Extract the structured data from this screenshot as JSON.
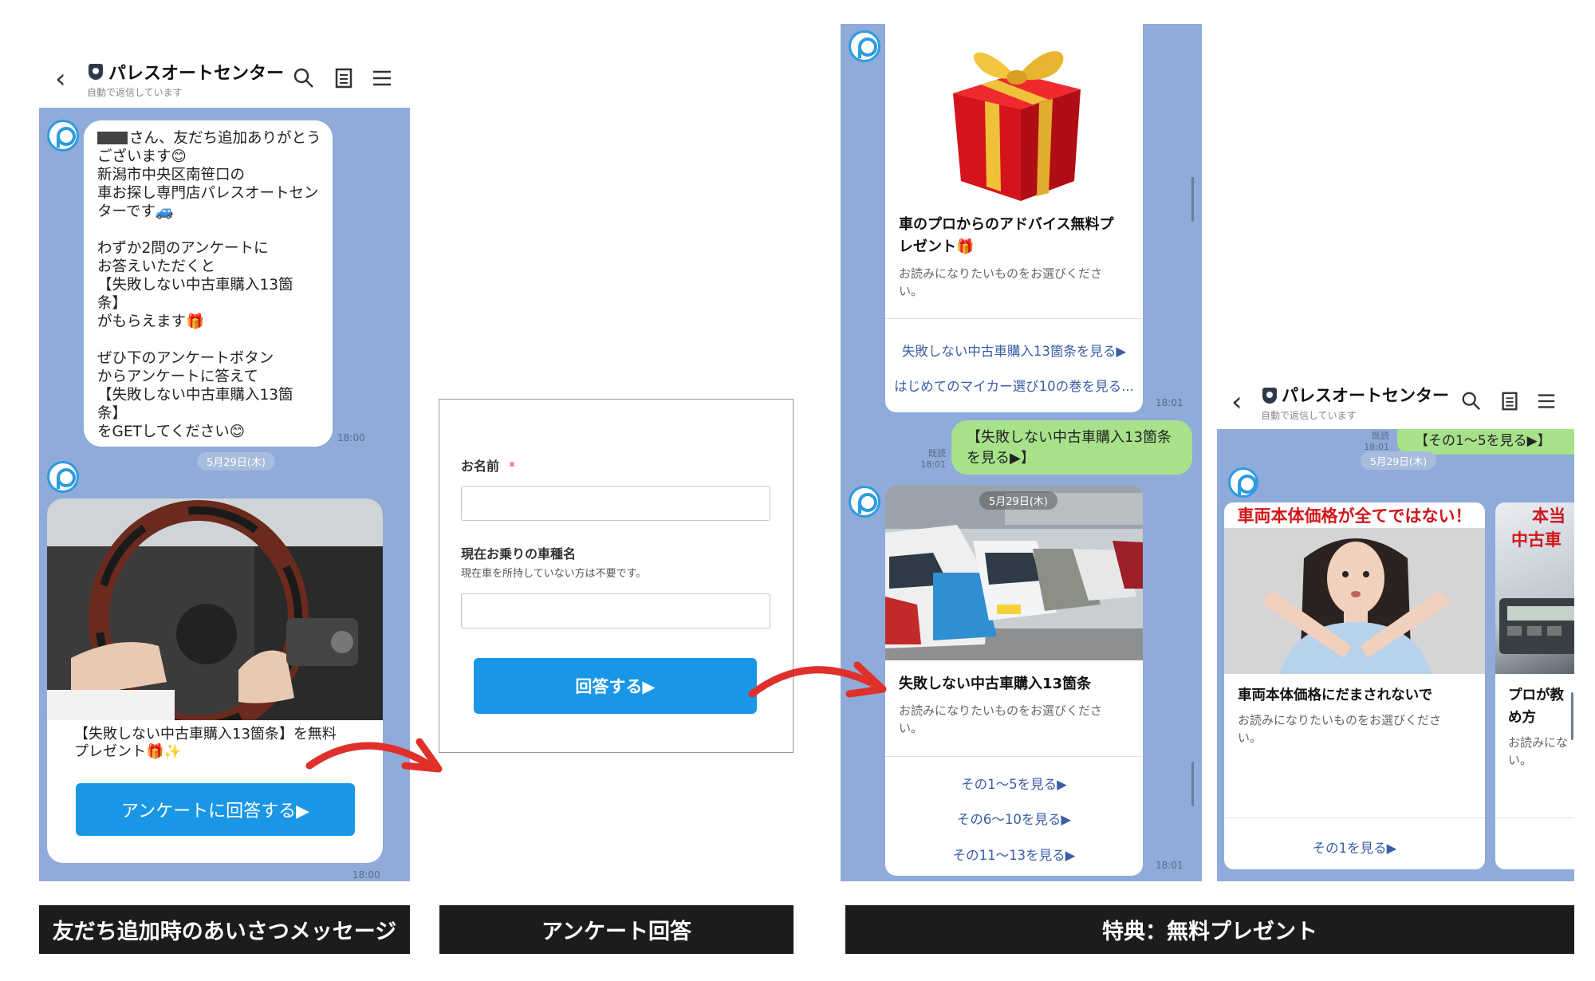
{
  "header": {
    "title": "パレスオートセンター",
    "subtitle": "自動で返信しています"
  },
  "panel1": {
    "greeting_parts": {
      "line1": "さん、友だち追加ありがとう",
      "rest": "ございます😊\n新潟市中央区南笹口の\n車お探し専門店パレスオートセン\nターです🚙\n\nわずか2問のアンケートに\nお答えいただくと\n【失敗しない中古車購入13箇\n条】\nがもらえます🎁\n\nぜひ下のアンケートボタン\nからアンケートに答えて\n【失敗しない中古車購入13箇\n条】\nをGETしてください😊"
    },
    "greeting_time": "18:00",
    "date_badge": "5月29日(木)",
    "card_text": "【失敗しない中古車購入13箇条】を無料\nプレゼント🎁✨",
    "survey_button": "アンケートに回答する▶",
    "card_time": "18:00"
  },
  "form": {
    "name_label": "お名前",
    "required_mark": "*",
    "car_label": "現在お乗りの車種名",
    "car_note": "現在車を所持していない方は不要です。",
    "submit_button": "回答する▶"
  },
  "panel3": {
    "gift_card": {
      "title": "車のプロからのアドバイス無料プ\nレゼント🎁",
      "desc": "お読みになりたいものをお選びくださ\nい。",
      "links": [
        "失敗しない中古車購入13箇条を見る▶",
        "はじめてのマイカー選び10の巻を見る..."
      ],
      "time": "18:01"
    },
    "sent_message": "【失敗しない中古車購入13箇条\nを見る▶】",
    "read_label": "既読",
    "sent_time": "18:01",
    "photo_date_overlay": "5月29日(木)",
    "list_card": {
      "title": "失敗しない中古車購入13箇条",
      "desc": "お読みになりたいものをお選びくださ\nい。",
      "links": [
        "その1～5を見る▶",
        "その6～10を見る▶",
        "その11～13を見る▶"
      ],
      "time": "18:01"
    }
  },
  "panel4": {
    "read_label": "既読",
    "read_time": "18:01",
    "date_badge": "5月29日(木)",
    "sent_message": "【その1～5を見る▶】",
    "banner_text": "車両本体価格が全てではない！",
    "card": {
      "title": "車両本体価格にだまされないで",
      "desc": "お読みになりたいものをお選びくださ\nい。",
      "link": "その1を見る▶"
    },
    "next_card": {
      "banner_line1": "本当",
      "banner_line2": "中古車",
      "title": "プロが教\nめ方",
      "desc": "お読みにな\nい。"
    }
  },
  "captions": [
    "友だち追加時のあいさつメッセージ",
    "アンケート回答",
    "特典：無料プレゼント"
  ],
  "colors": {
    "chat_background": "#8fabd9",
    "line_green": "#a7e28a",
    "button_blue": "#1a96e6",
    "arrow_red": "#e0302a",
    "caption_bg": "#1c1c1c"
  }
}
